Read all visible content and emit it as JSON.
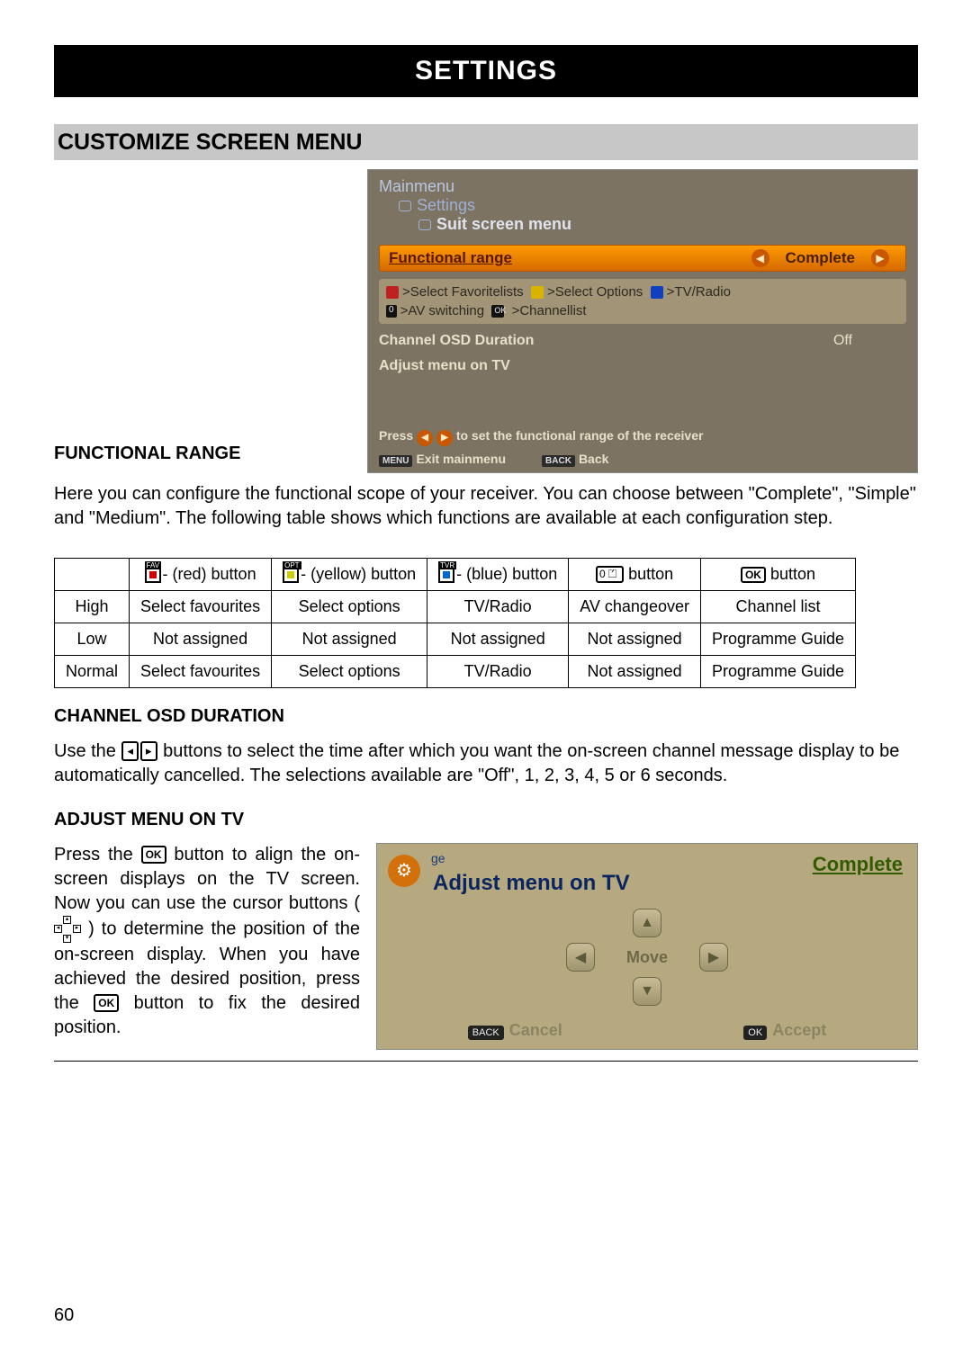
{
  "page_number": "60",
  "title": "SETTINGS",
  "section_heading": "CUSTOMIZE SCREEN MENU",
  "subheads": {
    "functional_range": "FUNCTIONAL RANGE",
    "channel_osd": "CHANNEL OSD DURATION",
    "adjust_menu": "ADJUST MENU ON TV"
  },
  "para": {
    "functional_range": "Here you can configure the functional scope of your receiver. You can choose between \"Complete\", \"Simple\" and \"Medium\". The following table shows which functions are available at each configuration step.",
    "channel_osd_pre": "Use the ",
    "channel_osd_post": " buttons to select the time after which you want the on-screen channel message display to be automatically cancelled. The selections available are \"Off\", 1, 2, 3, 4, 5 or 6 seconds.",
    "adjust_a_pre": "Press the ",
    "adjust_a_post": " button to align the on-screen displays on the TV screen. Now you can use the cursor buttons ( ",
    "adjust_b_post": " ) to determine the position of the on-screen display. When you have achieved the desired position, press the ",
    "adjust_c_post": " button to fix the desired position."
  },
  "tvshot1": {
    "crumb1": "Mainmenu",
    "crumb2": "Settings",
    "crumb3": "Suit screen menu",
    "sel_label": "Functional range",
    "sel_value": "Complete",
    "box_line1_a": ">Select Favoritelists",
    "box_line1_b": ">Select Options",
    "box_line1_c": ">TV/Radio",
    "box_line2_a": ">AV switching",
    "box_line2_b": ">Channellist",
    "row2_label": "Channel OSD Duration",
    "row2_value": "Off",
    "row3_label": "Adjust menu on TV",
    "hint_pre": "Press",
    "hint_post": "to set the functional range of the receiver",
    "foot_menu": "Exit mainmenu",
    "foot_back": "Back",
    "pill_menu": "MENU",
    "pill_back": "BACK"
  },
  "table": {
    "headers": {
      "c0": "",
      "c1": "- (red) button",
      "c2": "- (yellow) button",
      "c3": "- (blue) button",
      "c4": " button",
      "c5": " button"
    },
    "row_labels": [
      "High",
      "Low",
      "Normal"
    ],
    "rows": [
      [
        "Select favourites",
        "Select options",
        "TV/Radio",
        "AV changeover",
        "Channel list"
      ],
      [
        "Not assigned",
        "Not assigned",
        "Not assigned",
        "Not assigned",
        "Programme Guide"
      ],
      [
        "Select favourites",
        "Select options",
        "TV/Radio",
        "Not assigned",
        "Programme Guide"
      ]
    ],
    "icon_tags": {
      "fav": "FAV",
      "opt": "OPT",
      "tvr": "TVR"
    },
    "zero_icon": "0 ⏍",
    "ok_icon": "OK"
  },
  "tvshot2": {
    "crumb_small": "ge",
    "complete": "Complete",
    "title": "Adjust menu on TV",
    "move": "Move",
    "cancel": "Cancel",
    "accept": "Accept",
    "pill_back": "BACK",
    "pill_ok": "OK"
  }
}
